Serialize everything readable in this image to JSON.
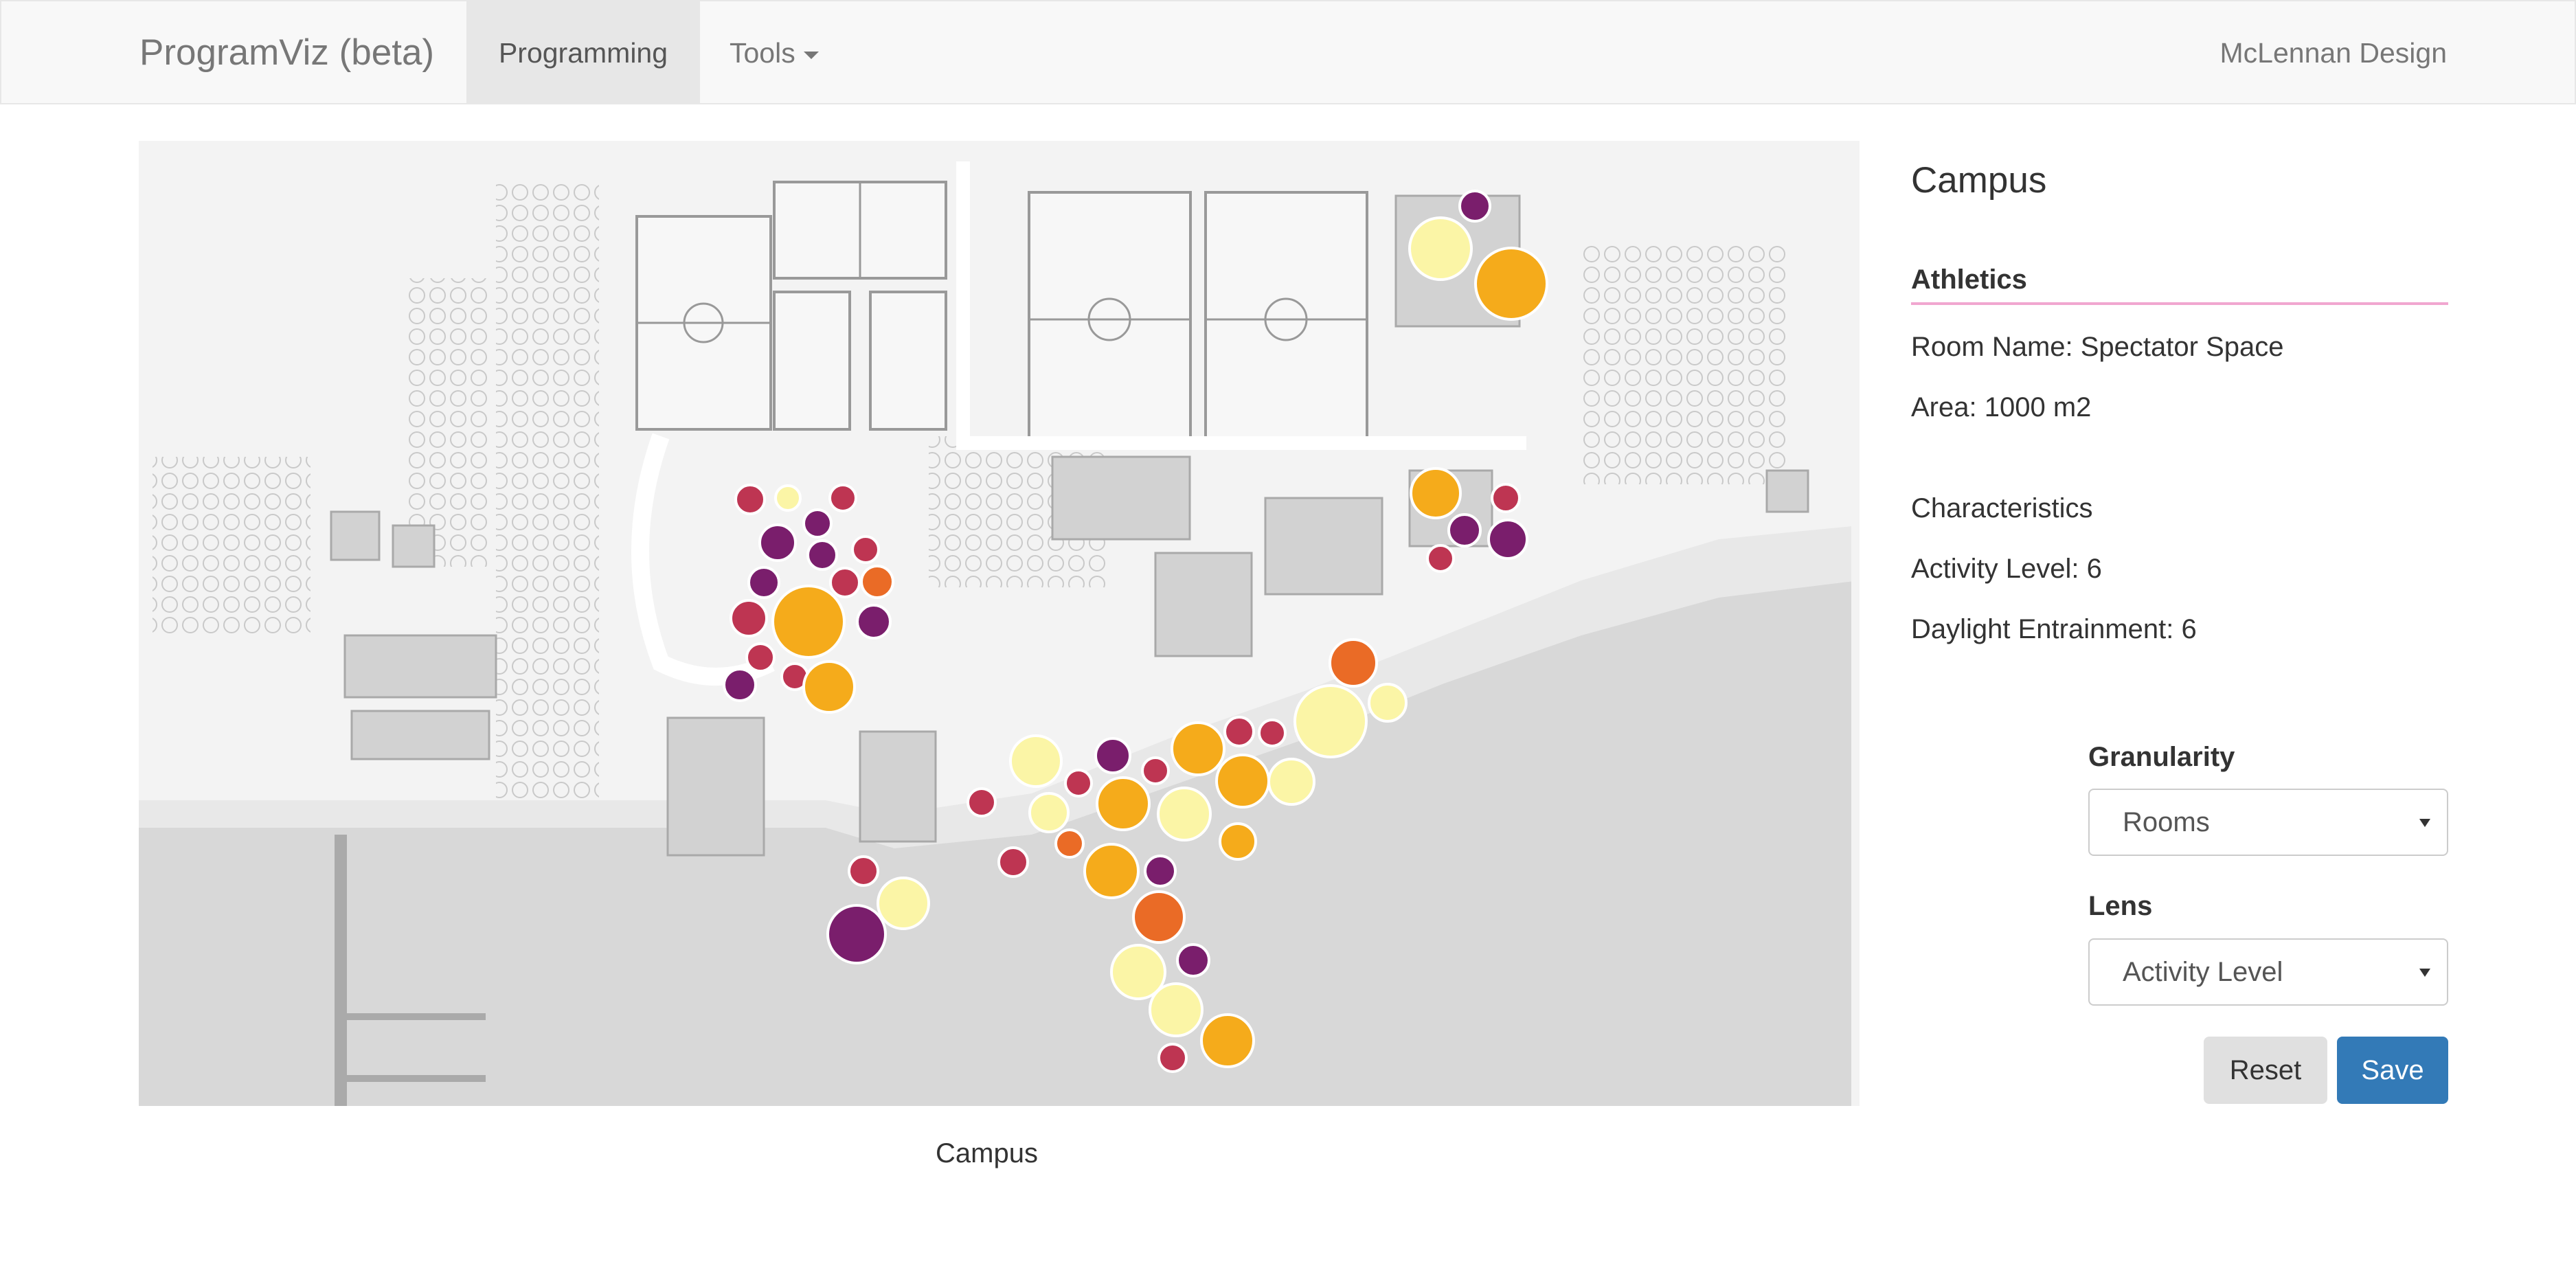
{
  "navbar": {
    "brand": "ProgramViz (beta)",
    "items": [
      {
        "label": "Programming",
        "active": true
      },
      {
        "label": "Tools",
        "dropdown": true
      }
    ],
    "right_label": "McLennan Design"
  },
  "map": {
    "caption": "Campus",
    "bubble_colors": {
      "pale_yellow": "#fbf5a6",
      "amber": "#f5ab1b",
      "orange": "#ea6b26",
      "crimson": "#be3552",
      "purple": "#7a1e6c"
    }
  },
  "panel": {
    "title": "Campus",
    "section": "Athletics",
    "section_rule_color": "#f1a7d0",
    "room_name": "Room Name: Spectator Space",
    "area": "Area: 1000 m2",
    "characteristics_label": "Characteristics",
    "activity_level": "Activity Level: 6",
    "daylight": "Daylight Entrainment: 6"
  },
  "controls": {
    "granularity_label": "Granularity",
    "granularity_value": "Rooms",
    "lens_label": "Lens",
    "lens_value": "Activity Level",
    "reset_label": "Reset",
    "save_label": "Save",
    "save_color": "#337ab7"
  }
}
